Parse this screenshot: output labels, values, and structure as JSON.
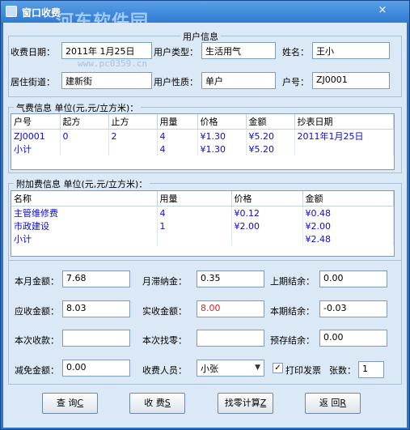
{
  "window": {
    "title": "窗口收费",
    "close_glyph": "×",
    "watermark": "河东软件园",
    "watermark_url": "www.pc0359.cn"
  },
  "user_info": {
    "title": "用户信息",
    "pay_date_label": "收费日期：",
    "pay_date": "2011年 1月25日",
    "user_type_label": "用户类型：",
    "user_type": "生活用气",
    "name_label": "姓名：",
    "name": "王小",
    "street_label": "居住街道：",
    "street": "建新街",
    "nature_label": "用户性质：",
    "nature": "单户",
    "account_label": "户号：",
    "account": "ZJ0001"
  },
  "gas_fee": {
    "title": "气费信息  单位(元,元/立方米)：",
    "columns": [
      "户号",
      "起方",
      "止方",
      "用量",
      "价格",
      "金额",
      "抄表日期"
    ],
    "rows": [
      [
        "ZJ0001",
        "0",
        "2",
        "4",
        "¥1.30",
        "¥5.20",
        "2011年1月25日"
      ],
      [
        "小计",
        "",
        "",
        "4",
        "¥1.30",
        "¥5.20",
        ""
      ]
    ]
  },
  "extra_fee": {
    "title": "附加费信息  单位(元,元/立方米)：",
    "columns": [
      "名称",
      "用量",
      "价格",
      "金额"
    ],
    "rows": [
      [
        "主管维修费",
        "4",
        "¥0.12",
        "¥0.48"
      ],
      [
        "市政建设",
        "1",
        "¥2.00",
        "¥2.00"
      ],
      [
        "小计",
        "",
        "",
        "¥2.48"
      ]
    ]
  },
  "summary": {
    "month_amount_label": "本月金额：",
    "month_amount": "7.68",
    "late_fee_label": "月滞纳金：",
    "late_fee": "0.35",
    "last_balance_label": "上期结余：",
    "last_balance": "0.00",
    "receivable_label": "应收金额：",
    "receivable": "8.03",
    "actual_label": "实收金额：",
    "actual": "8.00",
    "actual_color": "#e02020",
    "current_balance_label": "本期结余：",
    "current_balance": "-0.03",
    "this_pay_label": "本次收款：",
    "this_pay": "",
    "change_label": "本次找零：",
    "change": "",
    "prestore_label": "预存结余：",
    "prestore": "0.00",
    "discount_label": "减免金额：",
    "discount": "0.00",
    "collector_label": "收费人员：",
    "collector": "小张",
    "print_invoice_label": "打印发票",
    "print_invoice_checked": "✓",
    "sheets_label": "张数：",
    "sheets": "1"
  },
  "buttons": {
    "query": "查  询",
    "query_key": "C",
    "charge": "收  费",
    "charge_key": "S",
    "change_calc": "找零计算",
    "change_calc_key": "Z",
    "back": "返  回",
    "back_key": "R"
  }
}
